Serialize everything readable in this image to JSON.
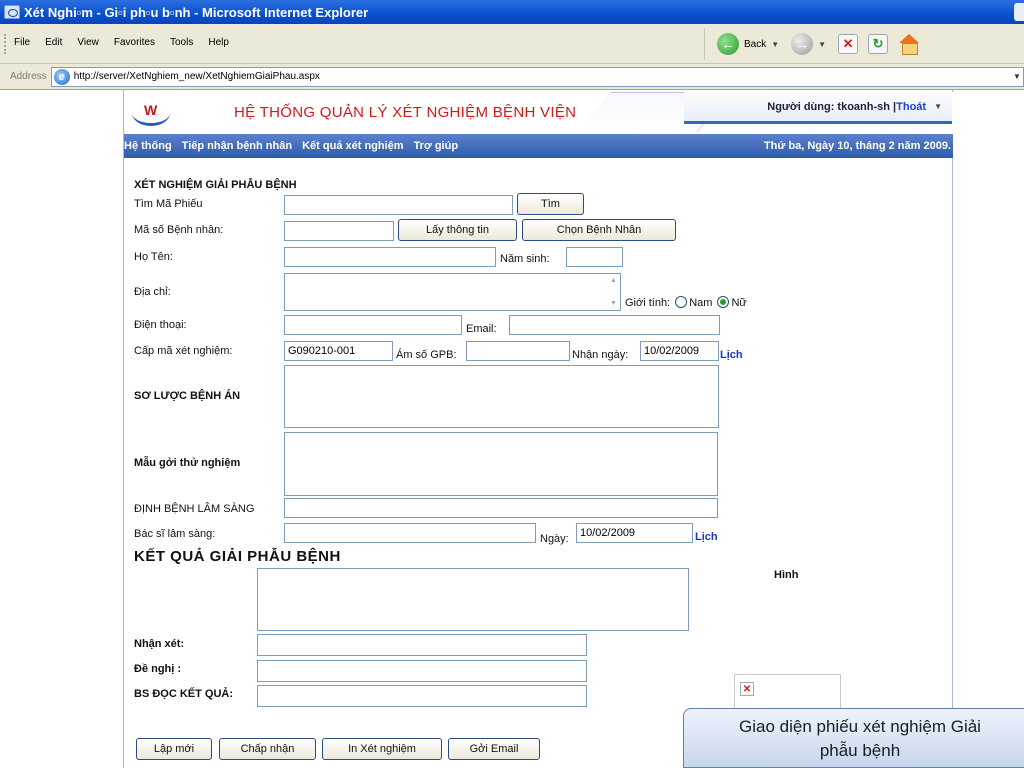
{
  "window": {
    "title": "Xét Nghi▫m - Gi▫i ph▫u b▫nh - Microsoft Internet Explorer"
  },
  "menu": [
    "File",
    "Edit",
    "View",
    "Favorites",
    "Tools",
    "Help"
  ],
  "toolbar": {
    "back_label": "Back"
  },
  "address": {
    "label": "Address",
    "url": "http://server/XetNghiem_new/XetNghiemGiaiPhau.aspx"
  },
  "header": {
    "system_title": "HỆ THỐNG QUẢN LÝ XÉT NGHIỆM BỆNH VIỆN",
    "user_prefix": "Người dùng: tkoanh-sh | ",
    "logout": "Thoát"
  },
  "nav": {
    "items": [
      "Hệ thống",
      "Tiếp nhận bệnh nhân",
      "Kết quả xét nghiệm",
      "Trợ giúp"
    ],
    "date": "Thứ ba, Ngày 10, tháng 2 năm 2009."
  },
  "form": {
    "section_title": "XÉT NGHIỆM GIẢI PHẪU BỆNH",
    "find_code_label": "Tìm Mã Phiếu",
    "find_button": "Tìm",
    "patient_id_label": "Mã số Bệnh nhân:",
    "get_info_button": "Lấy thông tin",
    "choose_patient_button": "Chọn Bệnh Nhân",
    "name_label": "Họ Tên:",
    "birth_year_label": "Năm sinh:",
    "address_label": "Địa chỉ:",
    "gender_label": "Giới tính:",
    "gender_male": "Nam",
    "gender_female": "Nữ",
    "phone_label": "Điện thoại:",
    "email_label": "Email:",
    "test_code_label": "Cấp mã xét nghiệm:",
    "test_code_value": "G090210-001",
    "gpb_label": "Ám số GPB:",
    "received_date_label": "Nhận ngày:",
    "received_date_value": "10/02/2009",
    "calendar_link": "Lịch",
    "history_label": "SƠ LƯỢC BỆNH ÁN",
    "sample_label": "Mẫu gởi thử nghiệm",
    "diagnosis_label": "ĐỊNH BỆNH LÂM SÀNG",
    "doctor_label": "Bác sĩ lâm sàng:",
    "date_label": "Ngày:",
    "date_value": "10/02/2009",
    "result_title": "KẾT QUẢ GIẢI PHẪU BỆNH",
    "image_label": "Hình",
    "comment_label": "Nhận xét:",
    "suggest_label": "Đề nghị :",
    "reader_label": "BS ĐỌC KẾT QUẢ:"
  },
  "buttons": {
    "new": "Lập mới",
    "accept": "Chấp nhận",
    "print": "In Xét nghiệm",
    "email": "Gởi Email"
  },
  "caption": {
    "line1": "Giao diện phiếu xét nghiệm Giải",
    "line2": "phẫu bệnh"
  },
  "colors": {
    "title_red": "#d21a1a",
    "nav_blue": "#2f5aad",
    "link_blue": "#1a33cc"
  }
}
